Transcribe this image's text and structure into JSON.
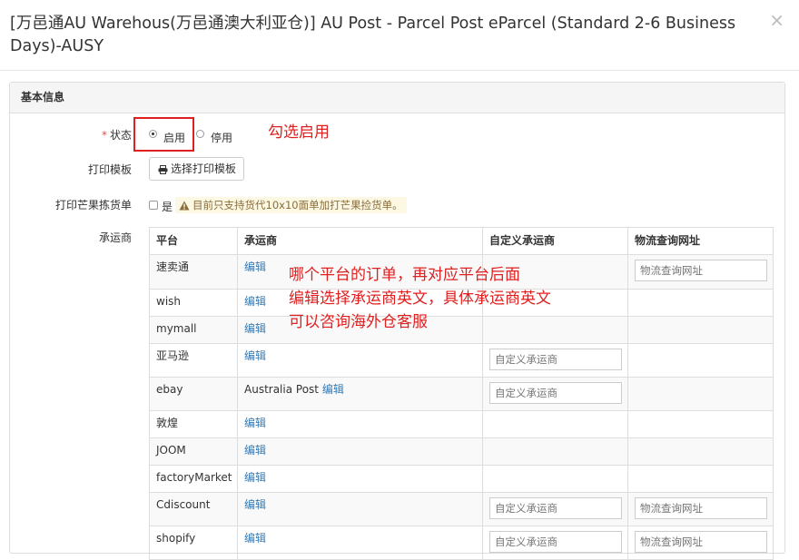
{
  "modal": {
    "title": "[万邑通AU Warehous(万邑通澳大利亚仓)] AU Post - Parcel Post eParcel (Standard 2-6 Business Days)-AUSY",
    "close": "×"
  },
  "panel": {
    "heading": "基本信息"
  },
  "form": {
    "status": {
      "required_mark": "*",
      "label": "状态",
      "options": [
        "启用",
        "停用"
      ],
      "selected": "启用"
    },
    "print_template": {
      "label": "打印模板",
      "button": "选择打印模板"
    },
    "mango_pick": {
      "label": "打印芒果拣货单",
      "checkbox_label": "是",
      "warning": "目前只支持货代10x10面单加打芒果捡货单。"
    },
    "carrier": {
      "label": "承运商"
    }
  },
  "table": {
    "headers": [
      "平台",
      "承运商",
      "自定义承运商",
      "物流查询网址"
    ],
    "edit_label": "编辑",
    "custom_placeholder": "自定义承运商",
    "url_placeholder": "物流查询网址",
    "rows": [
      {
        "platform": "速卖通",
        "carrier": "",
        "custom": false,
        "url": true
      },
      {
        "platform": "wish",
        "carrier": "",
        "custom": false,
        "url": false
      },
      {
        "platform": "mymall",
        "carrier": "",
        "custom": false,
        "url": false
      },
      {
        "platform": "亚马逊",
        "carrier": "",
        "custom": true,
        "url": false
      },
      {
        "platform": "ebay",
        "carrier": "Australia Post",
        "custom": true,
        "url": false
      },
      {
        "platform": "敦煌",
        "carrier": "",
        "custom": false,
        "url": false
      },
      {
        "platform": "JOOM",
        "carrier": "",
        "custom": false,
        "url": false
      },
      {
        "platform": "factoryMarket",
        "carrier": "",
        "custom": false,
        "url": false
      },
      {
        "platform": "Cdiscount",
        "carrier": "",
        "custom": true,
        "url": true
      },
      {
        "platform": "shopify",
        "carrier": "",
        "custom": true,
        "url": true
      }
    ]
  },
  "annotations": {
    "enable_note": "勾选启用",
    "carrier_note": [
      "哪个平台的订单，再对应平台后面",
      "编辑选择承运商英文，具体承运商英文",
      "可以咨询海外仓客服"
    ]
  },
  "colors": {
    "annotation": "#e02020",
    "link": "#337ab7",
    "warning_bg": "#fcf8e3"
  }
}
